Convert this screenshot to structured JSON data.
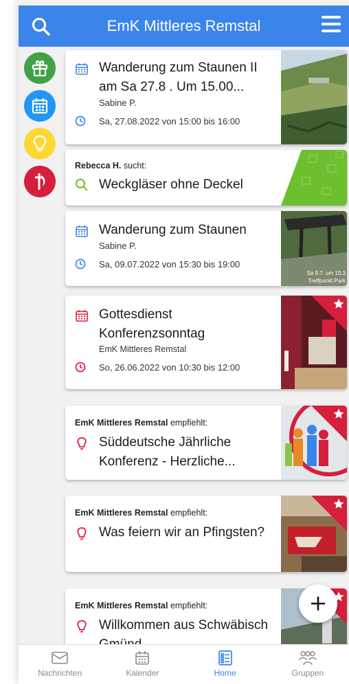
{
  "header": {
    "title": "EmK Mittleres Remstal",
    "search_icon": "search-icon",
    "menu_icon": "menu-icon"
  },
  "sidebar": [
    {
      "icon": "gift-icon",
      "color": "#43a047"
    },
    {
      "icon": "calendar-icon",
      "color": "#2196f3"
    },
    {
      "icon": "lightbulb-icon",
      "color": "#fdd835"
    },
    {
      "icon": "church-icon",
      "color": "#d61f3c"
    }
  ],
  "cards": [
    {
      "title": "Wanderung zum Staunen II am Sa 27.8 . Um 15.00...",
      "author": "Sabine P.",
      "date": "Sa, 27.08.2022 von 15:00 bis 16:00"
    },
    {
      "prefix_name": "Rebecca H.",
      "prefix_text": " sucht:",
      "title": "Weckgläser ohne Deckel"
    },
    {
      "title": "Wanderung zum Staunen",
      "author": "Sabine P.",
      "date": "Sa, 09.07.2022 von 15:30 bis 19:00",
      "img_caption": "Sa 9.7. um 15:3",
      "img_caption2": "Treffpunkt Park"
    },
    {
      "title": "Gottesdienst Konferenzsonntag",
      "author": "EmK Mittleres Remstal",
      "date": "So, 26.06.2022 von 10:30 bis 12:00"
    },
    {
      "prefix_name": "EmK Mittleres Remstal",
      "prefix_text": " empfiehlt:",
      "title": "Süddeutsche Jährliche Konferenz - Herzliche..."
    },
    {
      "prefix_name": "EmK Mittleres Remstal",
      "prefix_text": " empfiehlt:",
      "title": "Was feiern wir an Pfingsten?"
    },
    {
      "prefix_name": "EmK Mittleres Remstal",
      "prefix_text": " empfiehlt:",
      "title": "Willkommen aus Schwäbisch Gmünd"
    }
  ],
  "nav": [
    {
      "label": "Nachrichten",
      "icon": "mail-icon"
    },
    {
      "label": "Kalender",
      "icon": "calendar-icon"
    },
    {
      "label": "Home",
      "icon": "list-icon",
      "active": true
    },
    {
      "label": "Gruppen",
      "icon": "people-icon"
    }
  ],
  "colors": {
    "primary": "#3b84ea",
    "accent_red": "#d61f3c",
    "green": "#6cbf2f"
  }
}
